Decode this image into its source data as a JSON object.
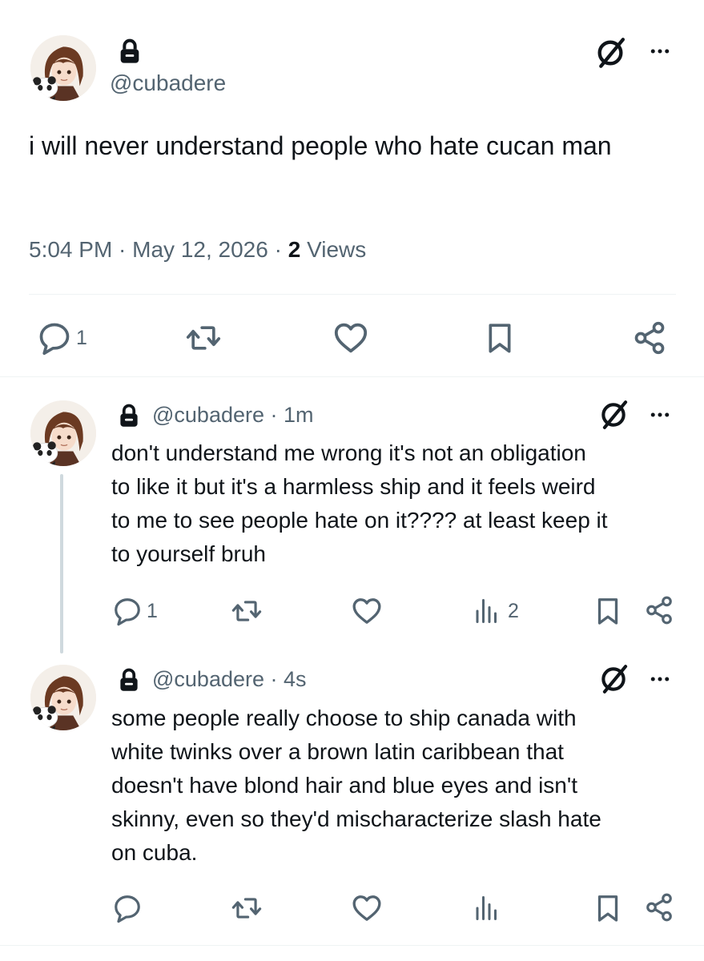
{
  "main_tweet": {
    "handle": "@cubadere",
    "text": "i will never understand people who hate cucan man",
    "time": "5:04 PM · May 12, 2026 · ",
    "views_count": "2",
    "views_label": " Views",
    "actions": {
      "reply_count": "1"
    }
  },
  "replies": [
    {
      "handle_time": "@cubadere · 1m",
      "text_lines": [
        "don't understand me wrong it's not an obligation",
        "to like it but it's a harmless ship and it feels weird",
        "to me to see people hate on it???? at least keep it",
        "to yourself bruh"
      ],
      "reply_count": "1",
      "views_count": "2"
    },
    {
      "handle_time": "@cubadere · 4s",
      "text_lines": [
        "some people really choose to ship canada with",
        "white twinks over a brown latin caribbean that",
        "doesn't have blond hair and blue eyes and isn't",
        "skinny, even so they'd mischaracterize slash hate",
        "on cuba."
      ]
    }
  ],
  "icons": {
    "lock": "lock-icon",
    "grok": "grok-icon",
    "more": "more-icon",
    "reply": "reply-icon",
    "repost": "repost-icon",
    "like": "like-icon",
    "bookmark": "bookmark-icon",
    "share": "share-icon",
    "views": "views-icon"
  }
}
